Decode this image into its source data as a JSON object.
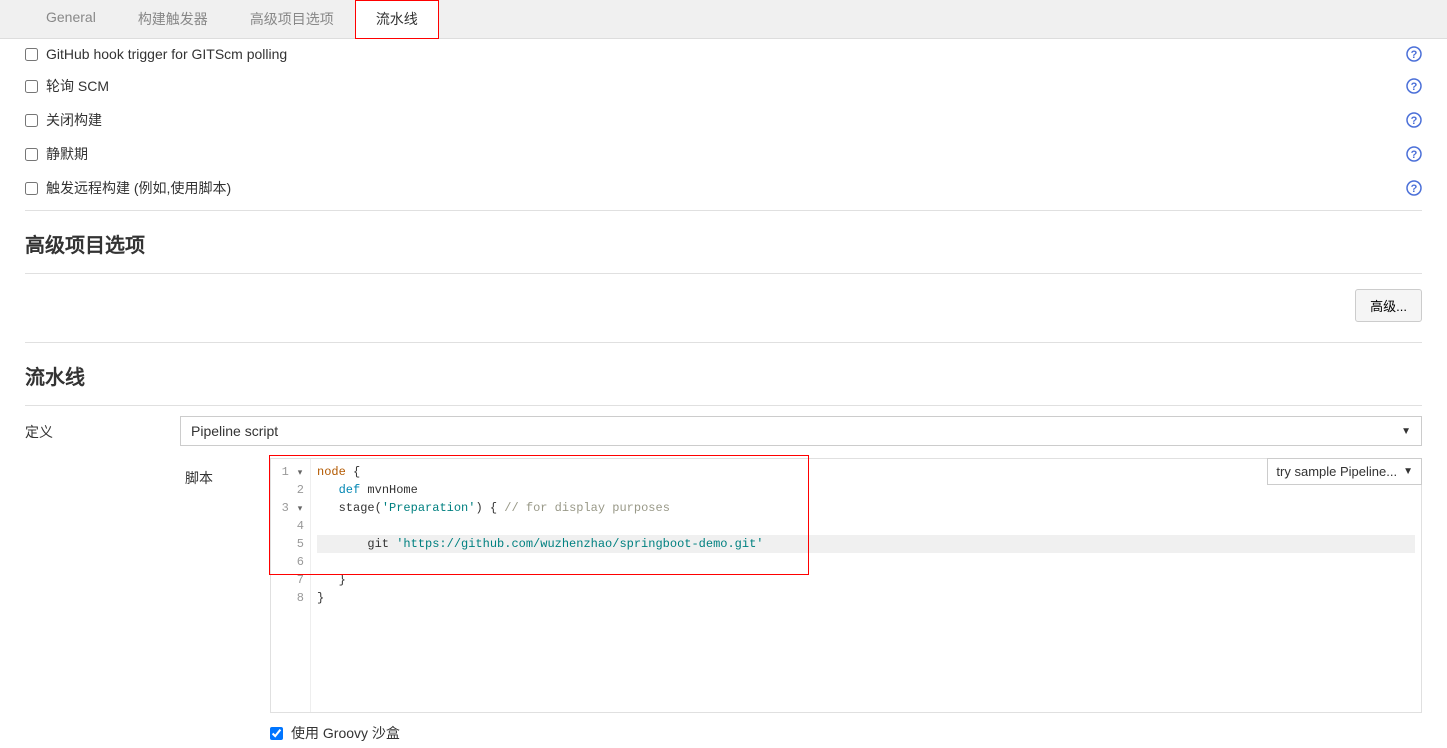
{
  "tabs": [
    {
      "label": "General",
      "active": false
    },
    {
      "label": "构建触发器",
      "active": false
    },
    {
      "label": "高级项目选项",
      "active": false
    },
    {
      "label": "流水线",
      "active": true
    }
  ],
  "triggers": [
    {
      "label": "GitHub hook trigger for GITScm polling",
      "checked": false
    },
    {
      "label": "轮询 SCM",
      "checked": false
    },
    {
      "label": "关闭构建",
      "checked": false
    },
    {
      "label": "静默期",
      "checked": false
    },
    {
      "label": "触发远程构建 (例如,使用脚本)",
      "checked": false
    }
  ],
  "sections": {
    "advanced_title": "高级项目选项",
    "pipeline_title": "流水线",
    "advanced_btn": "高级..."
  },
  "pipeline": {
    "definition_label": "定义",
    "definition_value": "Pipeline script",
    "script_label": "脚本",
    "sample_label": "try sample Pipeline...",
    "sandbox_label": "使用 Groovy 沙盒",
    "sandbox_checked": true
  },
  "code": {
    "gutter": [
      {
        "n": "1",
        "fold": true
      },
      {
        "n": "2",
        "fold": false
      },
      {
        "n": "3",
        "fold": true
      },
      {
        "n": "4",
        "fold": false
      },
      {
        "n": "5",
        "fold": false
      },
      {
        "n": "6",
        "fold": false
      },
      {
        "n": "7",
        "fold": false
      },
      {
        "n": "8",
        "fold": false
      }
    ],
    "lines": {
      "l1_kw": "node",
      "l1_rest": " {",
      "l2_def": "def",
      "l2_rest": " mvnHome",
      "l3_fn": "stage",
      "l3_p1": "(",
      "l3_str": "'Preparation'",
      "l3_p2": ") { ",
      "l3_cmt": "// for display purposes",
      "l5_pre": "       git ",
      "l5_str": "'https://github.com/wuzhenzhao/springboot-demo.git'",
      "l7": "   }",
      "l8": "}"
    }
  }
}
